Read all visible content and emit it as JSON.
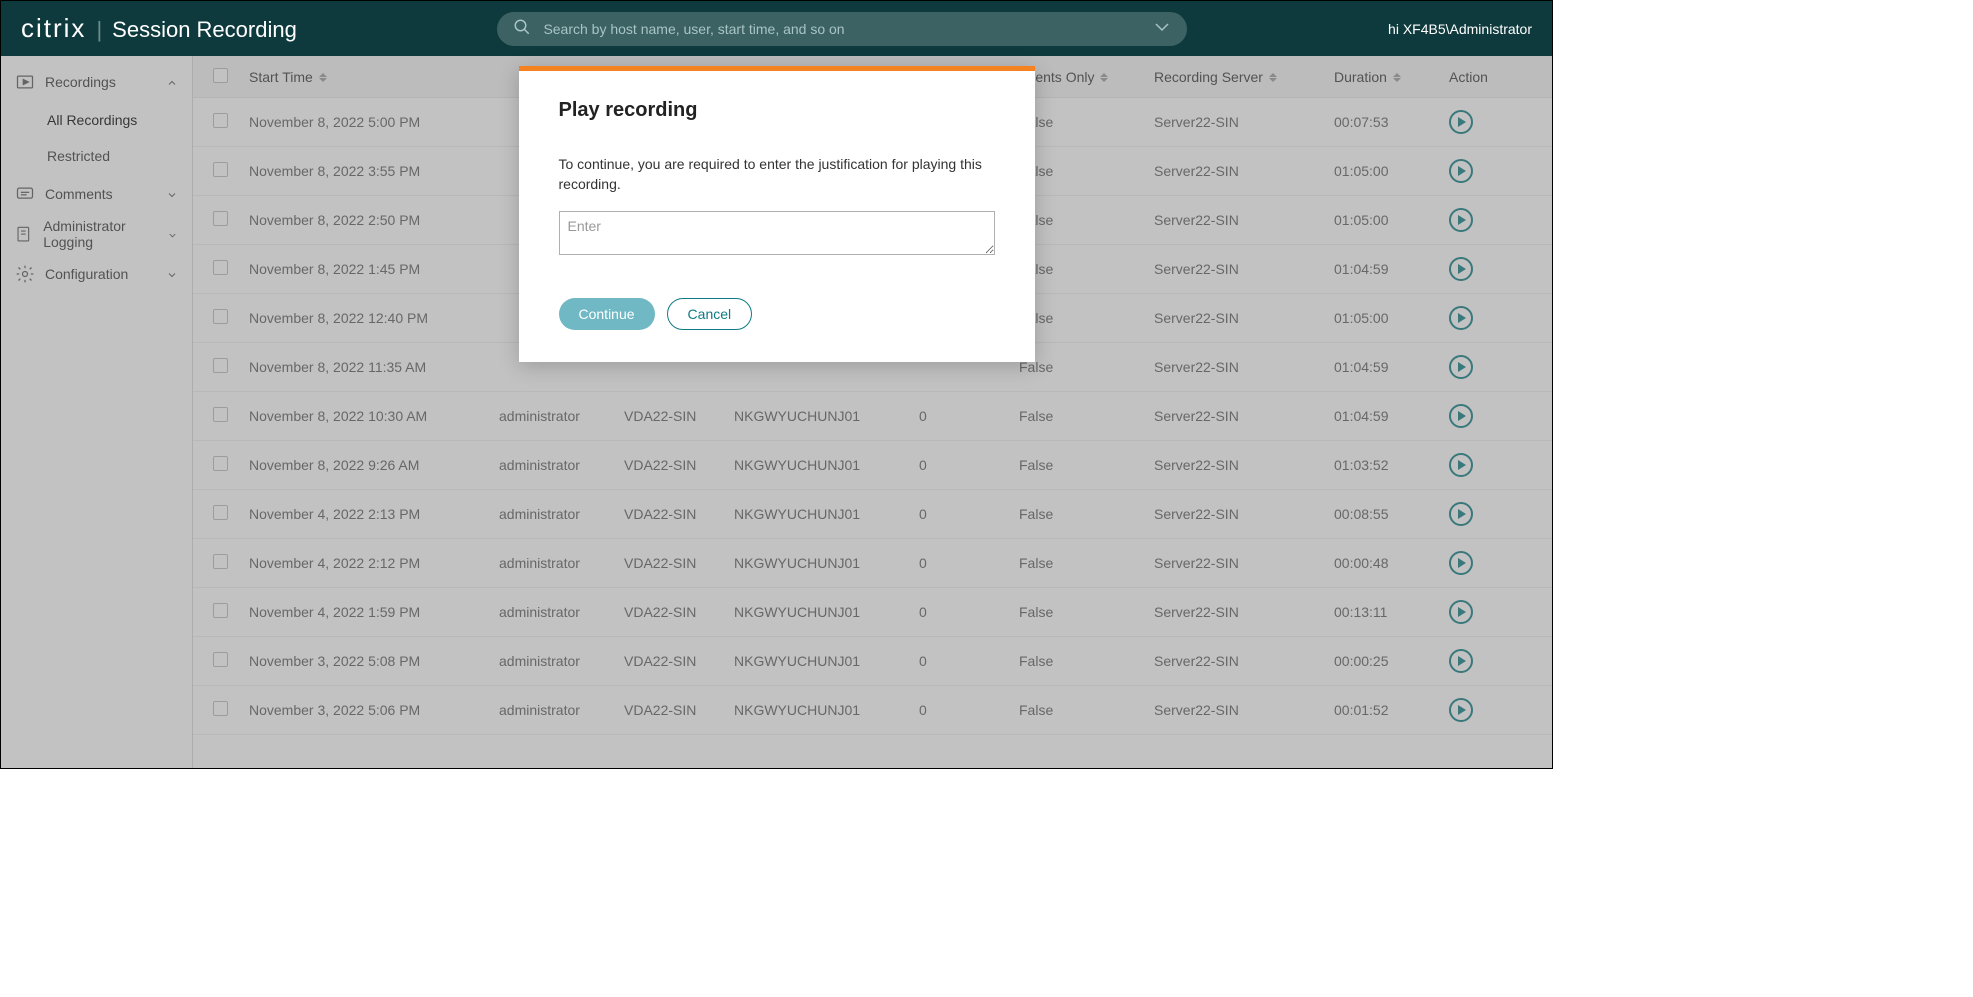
{
  "header": {
    "brand_main": "citrix",
    "brand_sep": "|",
    "brand_product": "Session Recording",
    "search_placeholder": "Search by host name, user, start time, and so on",
    "user_greeting": "hi XF4B5\\Administrator"
  },
  "sidebar": {
    "recordings_label": "Recordings",
    "all_recordings_label": "All Recordings",
    "restricted_label": "Restricted",
    "comments_label": "Comments",
    "admin_logging_label": "Administrator Logging",
    "configuration_label": "Configuration"
  },
  "table": {
    "headers": {
      "start_time": "Start Time",
      "events_only": "Events Only",
      "recording_server": "Recording Server",
      "duration": "Duration",
      "action": "Action"
    },
    "rows": [
      {
        "start": "November 8, 2022 5:00 PM",
        "user": "",
        "host": "",
        "client": "",
        "events": "",
        "eventsonly": "False",
        "server": "Server22-SIN",
        "duration": "00:07:53"
      },
      {
        "start": "November 8, 2022 3:55 PM",
        "user": "",
        "host": "",
        "client": "",
        "events": "",
        "eventsonly": "False",
        "server": "Server22-SIN",
        "duration": "01:05:00"
      },
      {
        "start": "November 8, 2022 2:50 PM",
        "user": "",
        "host": "",
        "client": "",
        "events": "",
        "eventsonly": "False",
        "server": "Server22-SIN",
        "duration": "01:05:00"
      },
      {
        "start": "November 8, 2022 1:45 PM",
        "user": "",
        "host": "",
        "client": "",
        "events": "",
        "eventsonly": "False",
        "server": "Server22-SIN",
        "duration": "01:04:59"
      },
      {
        "start": "November 8, 2022 12:40 PM",
        "user": "",
        "host": "",
        "client": "",
        "events": "",
        "eventsonly": "False",
        "server": "Server22-SIN",
        "duration": "01:05:00"
      },
      {
        "start": "November 8, 2022 11:35 AM",
        "user": "",
        "host": "",
        "client": "",
        "events": "",
        "eventsonly": "False",
        "server": "Server22-SIN",
        "duration": "01:04:59"
      },
      {
        "start": "November 8, 2022 10:30 AM",
        "user": "administrator",
        "host": "VDA22-SIN",
        "client": "NKGWYUCHUNJ01",
        "events": "0",
        "eventsonly": "False",
        "server": "Server22-SIN",
        "duration": "01:04:59"
      },
      {
        "start": "November 8, 2022 9:26 AM",
        "user": "administrator",
        "host": "VDA22-SIN",
        "client": "NKGWYUCHUNJ01",
        "events": "0",
        "eventsonly": "False",
        "server": "Server22-SIN",
        "duration": "01:03:52"
      },
      {
        "start": "November 4, 2022 2:13 PM",
        "user": "administrator",
        "host": "VDA22-SIN",
        "client": "NKGWYUCHUNJ01",
        "events": "0",
        "eventsonly": "False",
        "server": "Server22-SIN",
        "duration": "00:08:55"
      },
      {
        "start": "November 4, 2022 2:12 PM",
        "user": "administrator",
        "host": "VDA22-SIN",
        "client": "NKGWYUCHUNJ01",
        "events": "0",
        "eventsonly": "False",
        "server": "Server22-SIN",
        "duration": "00:00:48"
      },
      {
        "start": "November 4, 2022 1:59 PM",
        "user": "administrator",
        "host": "VDA22-SIN",
        "client": "NKGWYUCHUNJ01",
        "events": "0",
        "eventsonly": "False",
        "server": "Server22-SIN",
        "duration": "00:13:11"
      },
      {
        "start": "November 3, 2022 5:08 PM",
        "user": "administrator",
        "host": "VDA22-SIN",
        "client": "NKGWYUCHUNJ01",
        "events": "0",
        "eventsonly": "False",
        "server": "Server22-SIN",
        "duration": "00:00:25"
      },
      {
        "start": "November 3, 2022 5:06 PM",
        "user": "administrator",
        "host": "VDA22-SIN",
        "client": "NKGWYUCHUNJ01",
        "events": "0",
        "eventsonly": "False",
        "server": "Server22-SIN",
        "duration": "00:01:52"
      }
    ]
  },
  "modal": {
    "title": "Play recording",
    "message": "To continue, you are required to enter the justification for playing this recording.",
    "placeholder": "Enter",
    "continue_label": "Continue",
    "cancel_label": "Cancel"
  }
}
